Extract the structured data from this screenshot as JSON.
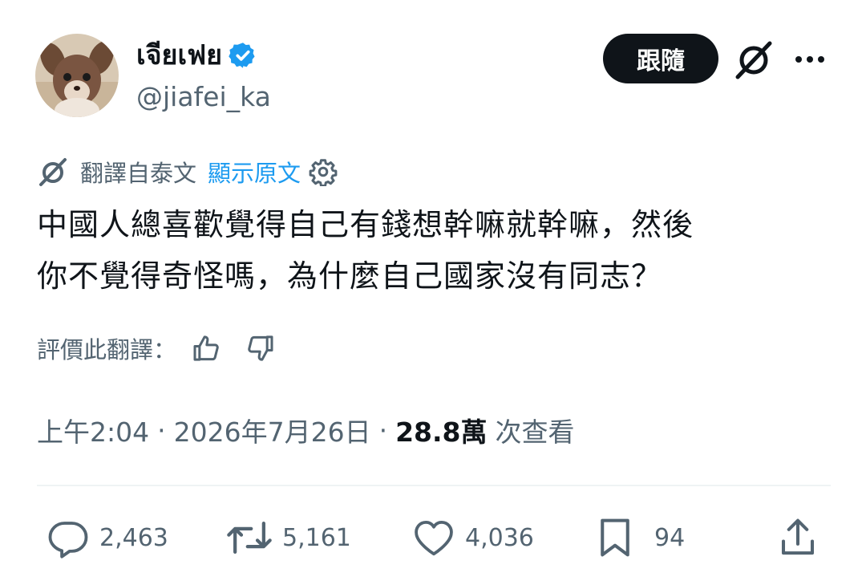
{
  "author": {
    "display_name": "เจียเฟย",
    "handle": "@jiafei_ka",
    "avatar_icon": "chihuahua-avatar",
    "verified_icon": "verified-badge-icon"
  },
  "header": {
    "follow_label": "跟隨",
    "grok_icon": "grok-icon",
    "more_icon": "more-dots-icon"
  },
  "translation": {
    "translated_from": "翻譯自泰文",
    "show_original": "顯示原文",
    "rate_label": "評價此翻譯：",
    "icons": [
      "globe-icon",
      "gear-icon",
      "thumbs-up-icon",
      "thumbs-down-icon"
    ]
  },
  "tweet": {
    "text_line1": "中國人總喜歡覺得自己有錢想幹嘛就幹嘛，然後",
    "text_line2": "你不覺得奇怪嗎，為什麼自己國家沒有同志？"
  },
  "meta": {
    "time": "上午2:04",
    "dot1": "·",
    "date": "2026年7月26日",
    "dot2": "·",
    "views_count": "28.8萬",
    "views_label": "次查看"
  },
  "actions": {
    "replies": "2,463",
    "reposts": "5,161",
    "likes": "4,036",
    "bookmarks": "94"
  },
  "colors": {
    "text": "#0f1419",
    "secondary": "#536471",
    "link": "#1d9bf0",
    "verified": "#1d9bf0",
    "follow_bg": "#0f1419"
  }
}
